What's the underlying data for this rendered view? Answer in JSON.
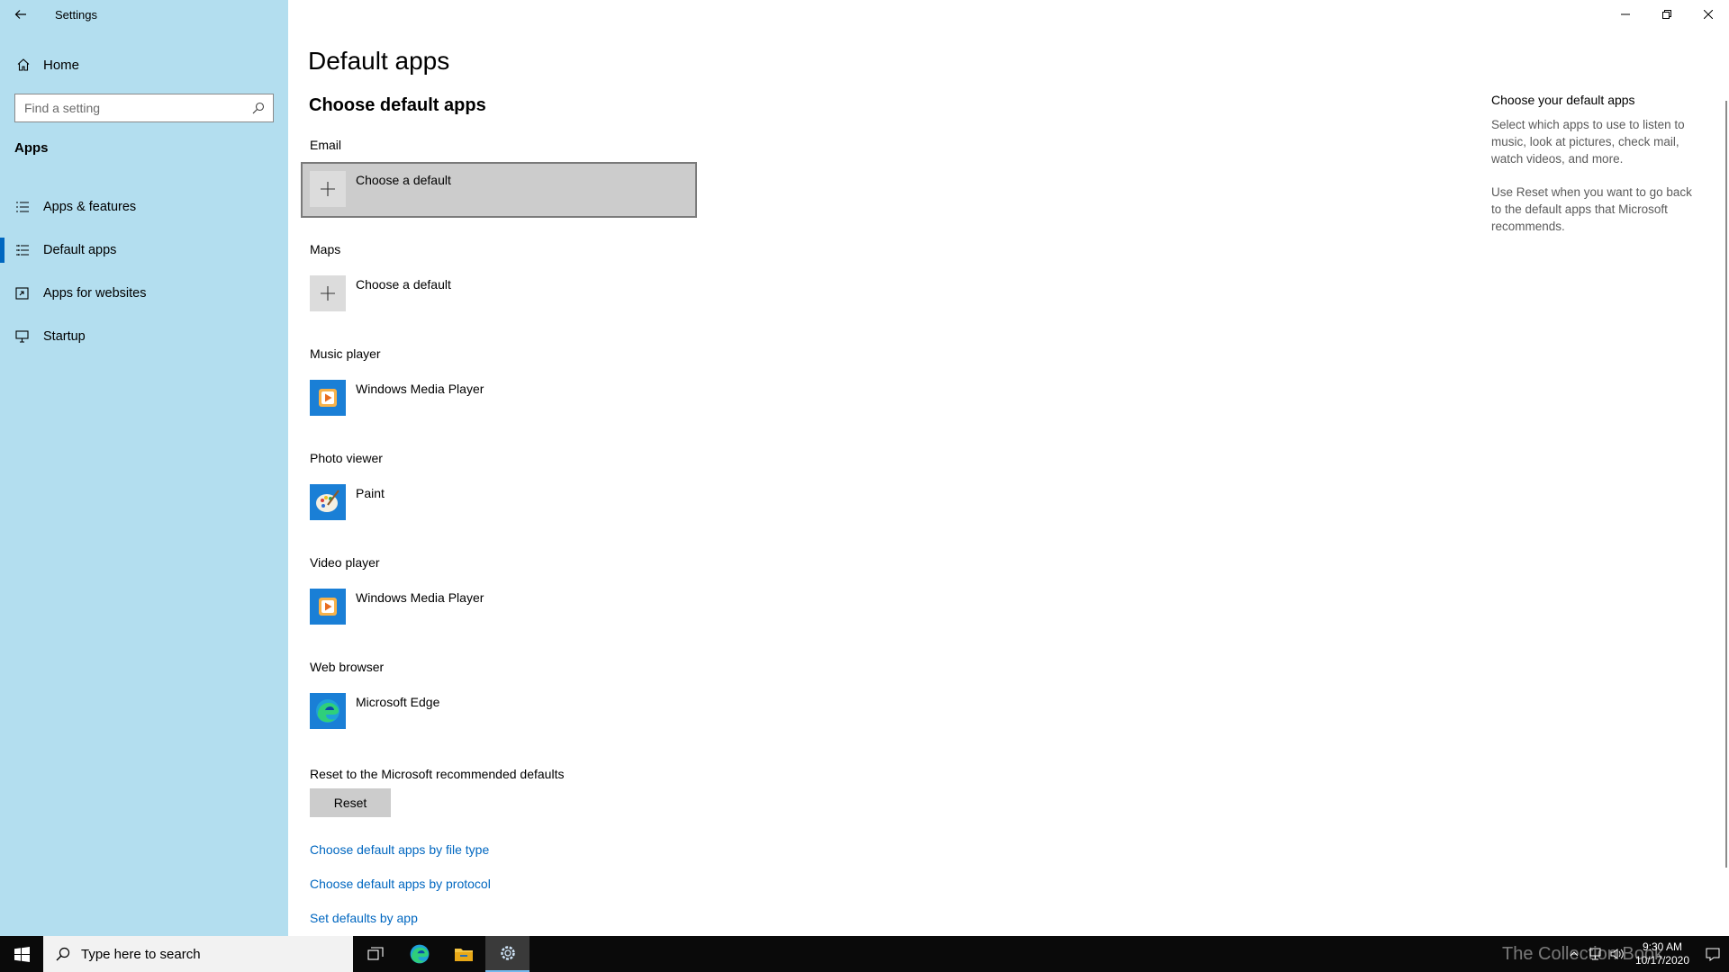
{
  "window": {
    "title": "Settings",
    "controls": {
      "minimize": "minimize-icon",
      "restore": "restore-icon",
      "close": "close-icon"
    }
  },
  "sidebar": {
    "home_label": "Home",
    "search_placeholder": "Find a setting",
    "section_label": "Apps",
    "items": [
      {
        "label": "Apps & features",
        "icon": "list-icon",
        "selected": false
      },
      {
        "label": "Default apps",
        "icon": "default-apps-icon",
        "selected": true
      },
      {
        "label": "Apps for websites",
        "icon": "web-link-icon",
        "selected": false
      },
      {
        "label": "Startup",
        "icon": "startup-icon",
        "selected": false
      }
    ]
  },
  "main": {
    "page_title": "Default apps",
    "subtitle": "Choose default apps",
    "groups": [
      {
        "label": "Email",
        "app": "Choose a default",
        "icon": "plus-icon"
      },
      {
        "label": "Maps",
        "app": "Choose a default",
        "icon": "plus-icon"
      },
      {
        "label": "Music player",
        "app": "Windows Media Player",
        "icon": "windows-media-player-icon"
      },
      {
        "label": "Photo viewer",
        "app": "Paint",
        "icon": "paint-icon"
      },
      {
        "label": "Video player",
        "app": "Windows Media Player",
        "icon": "windows-media-player-icon"
      },
      {
        "label": "Web browser",
        "app": "Microsoft Edge",
        "icon": "microsoft-edge-icon"
      }
    ],
    "reset_label": "Reset to the Microsoft recommended defaults",
    "reset_button": "Reset",
    "links": [
      "Choose default apps by file type",
      "Choose default apps by protocol",
      "Set defaults by app"
    ]
  },
  "side_info": {
    "heading": "Choose your default apps",
    "paragraph1": "Select which apps to use to listen to music, look at pictures, check mail, watch videos, and more.",
    "paragraph2": "Use Reset when you want to go back to the default apps that Microsoft recommends."
  },
  "taskbar": {
    "search_placeholder": "Type here to search",
    "time": "9:30 AM",
    "date": "10/17/2020",
    "watermark": "The Collection Book"
  },
  "colors": {
    "sidebar_bg": "#b3deef",
    "accent": "#0067c0",
    "taskbar_bg": "#0a0a0a"
  }
}
